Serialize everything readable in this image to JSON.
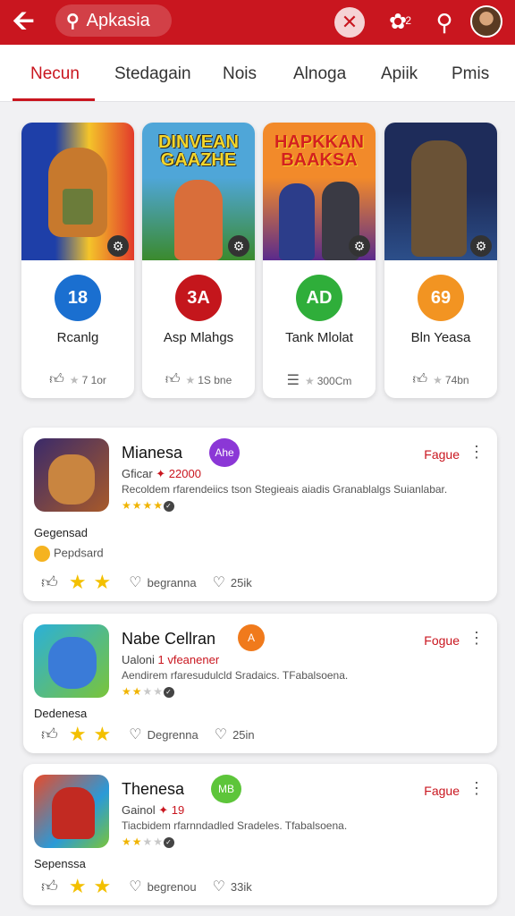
{
  "header": {
    "search_text": "Apkasia",
    "notification_count": "2"
  },
  "tabs": [
    {
      "label": "Necun",
      "active": true
    },
    {
      "label": "Stedagain"
    },
    {
      "label": "Nois"
    },
    {
      "label": "Alnoga"
    },
    {
      "label": "Apiik"
    },
    {
      "label": "Pmis"
    }
  ],
  "games": [
    {
      "title_art": "",
      "badge": "18",
      "badge_color": "#1a6fd0",
      "name": "Rcanlg",
      "stat": "7 1or"
    },
    {
      "title_art": "DINVEAN GAAZHE",
      "badge": "3A",
      "badge_color": "#c4161c",
      "name": "Asp Mlahgs",
      "stat": "1S bne"
    },
    {
      "title_art": "HAPKKAN BAAKSA",
      "badge": "AD",
      "badge_color": "#2fae3a",
      "name": "Tank Mlolat",
      "stat": "300Cm"
    },
    {
      "title_art": "",
      "badge": "69",
      "badge_color": "#f29422",
      "name": "Bln Yeasa",
      "stat": "74bn"
    }
  ],
  "list": [
    {
      "name": "Mianesa",
      "badge": "Ahe",
      "badge_color": "#8b37d6",
      "sub": "Gficar",
      "sub_value": "✦ 22000",
      "desc": "Recoldem rfarendeiics tson Stegieais aiadis Granablalgs Suianlabar.",
      "stars": 4,
      "action": "Fague",
      "category": "Gegensad",
      "extra": "Pepdsard",
      "stat1": "begranna",
      "stat2": "25ik"
    },
    {
      "name": "Nabe Cellran",
      "badge": "A",
      "badge_color": "#f07a1c",
      "sub": "Ualoni",
      "sub_value": "1 vfeanener",
      "desc": "Aendirem rfaresudulcld Sradaics. TFabalsoena.",
      "stars": 2,
      "action": "Fogue",
      "category": "Dedenesa",
      "extra": "",
      "stat1": "Degrenna",
      "stat2": "25in"
    },
    {
      "name": "Thenesa",
      "badge": "MB",
      "badge_color": "#5dc53a",
      "sub": "Gainol",
      "sub_value": "✦ 19",
      "desc": "Tiacbidem rfarnndadled Sradeles. Tfabalsoena.",
      "stars": 2,
      "action": "Fague",
      "category": "Sepenssa",
      "extra": "",
      "stat1": "begrenou",
      "stat2": "33ik"
    }
  ]
}
